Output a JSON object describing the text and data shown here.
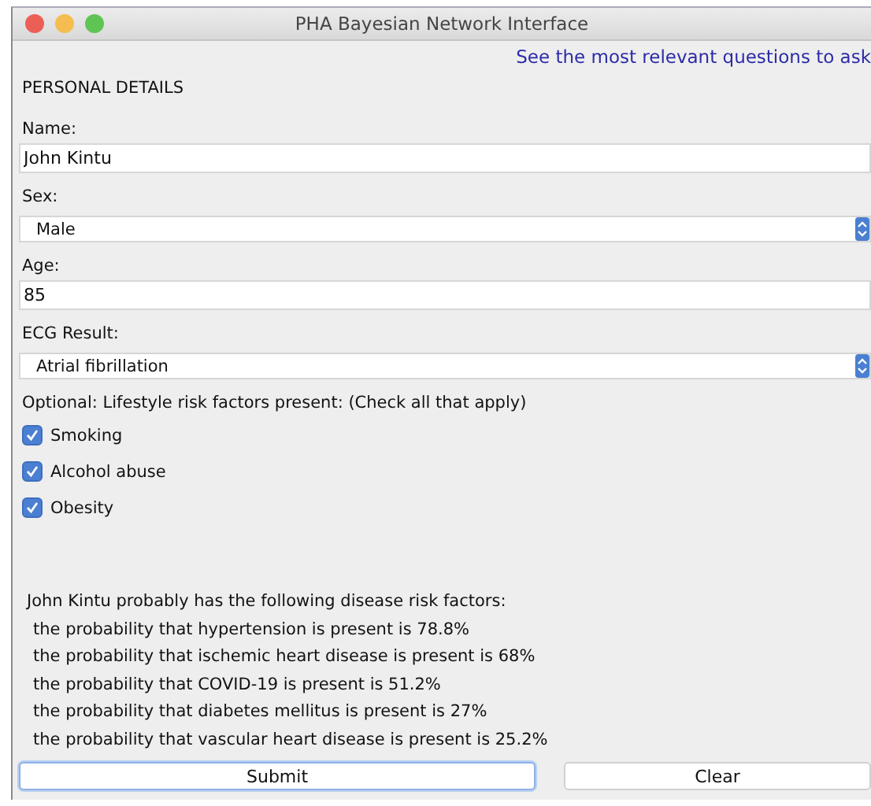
{
  "window": {
    "title": "PHA Bayesian Network Interface"
  },
  "top_link": "See the most relevant questions to ask",
  "section_title": "PERSONAL DETAILS",
  "fields": [
    {
      "kind": "text",
      "label": "Name:",
      "value": "John Kintu"
    },
    {
      "kind": "select",
      "label": "Sex:",
      "value": "Male"
    },
    {
      "kind": "text",
      "label": "Age:",
      "value": "85"
    },
    {
      "kind": "select",
      "label": "ECG Result:",
      "value": "Atrial fibrillation"
    }
  ],
  "lifestyle": {
    "label": "Optional: Lifestyle risk factors present: (Check all that apply)",
    "options": [
      {
        "label": "Smoking",
        "checked": true
      },
      {
        "label": "Alcohol abuse",
        "checked": true
      },
      {
        "label": "Obesity",
        "checked": true
      }
    ]
  },
  "results": {
    "heading": "John Kintu probably has the following disease risk factors:",
    "lines": [
      "the probability that hypertension is present is 78.8%",
      "the probability that ischemic heart disease is present is 68%",
      "the probability that COVID-19 is present is 51.2%",
      "the probability that diabetes mellitus is present is 27%",
      "the probability that vascular heart disease is present is 25.2%"
    ]
  },
  "buttons": [
    {
      "label": "Submit",
      "focused": true
    },
    {
      "label": "Clear",
      "focused": false
    }
  ]
}
